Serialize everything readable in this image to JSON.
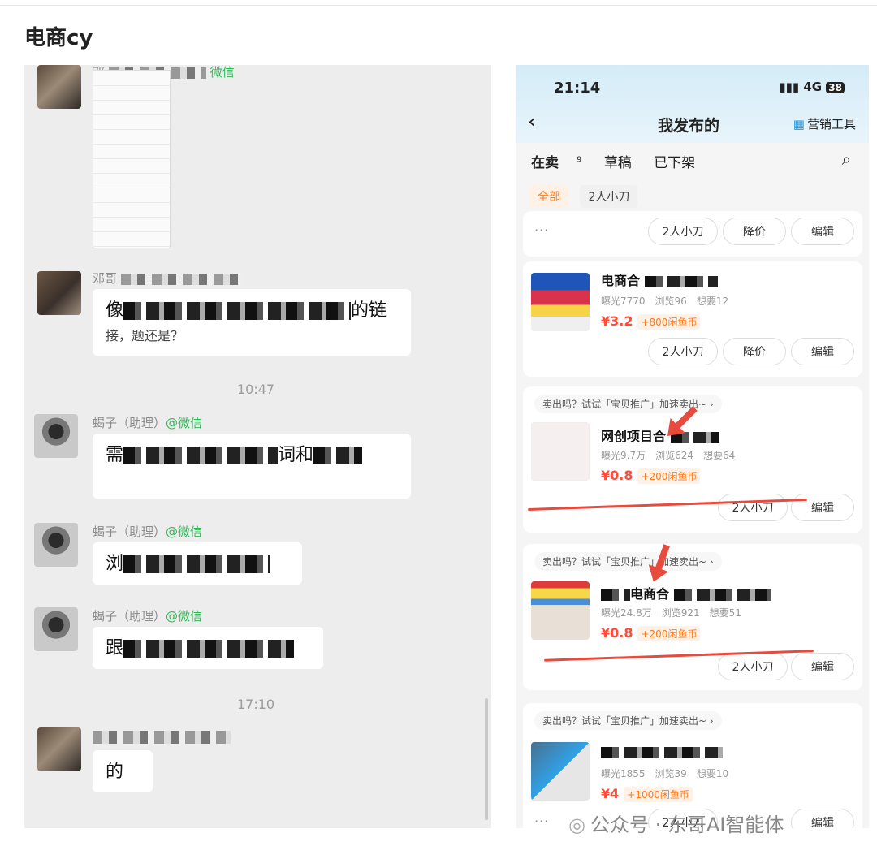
{
  "page_title": "电商cy",
  "chat": {
    "messages": [
      {
        "nick": "邓",
        "wx": "微信"
      },
      {
        "nick": "邓哥",
        "wx": "",
        "text_start": "像",
        "text_end": "的链",
        "text_line2": "接，题还是？"
      },
      {
        "time": "10:47"
      },
      {
        "nick": "蝎子（助理）",
        "wx": "@微信",
        "text_start": "需",
        "text_end": "词和"
      },
      {
        "nick": "蝎子（助理）",
        "wx": "@微信",
        "text_start": "浏"
      },
      {
        "nick": "蝎子（助理）",
        "wx": "@微信",
        "text_start": "跟"
      },
      {
        "time": "17:10"
      },
      {
        "nick": "",
        "wx": "",
        "text_end": "的"
      }
    ]
  },
  "phone": {
    "status_time": "21:14",
    "status_net": "4G",
    "battery": "38",
    "back_icon": "chevron-left-icon",
    "title": "我发布的",
    "tools_label": "营销工具",
    "tabs": [
      {
        "label": "在卖",
        "badge": "9"
      },
      {
        "label": "草稿"
      },
      {
        "label": "已下架"
      }
    ],
    "filters": [
      "全部",
      "2人小刀"
    ],
    "top_actions": [
      "2人小刀",
      "降价",
      "编辑"
    ],
    "promo_text": "卖出吗？试试「宝贝推广」加速卖出~",
    "products": [
      {
        "title": "电商合",
        "exposure": "曝光7770",
        "views": "浏览96",
        "wants": "想要12",
        "price": "¥3.2",
        "coin": "+800闲鱼币",
        "actions": [
          "2人小刀",
          "降价",
          "编辑"
        ]
      },
      {
        "title": "网创项目合",
        "exposure": "曝光9.7万",
        "views": "浏览624",
        "wants": "想要64",
        "price": "¥0.8",
        "coin": "+200闲鱼币",
        "actions": [
          "2人小刀",
          "编辑"
        ]
      },
      {
        "title": "电商合",
        "exposure": "曝光24.8万",
        "views": "浏览921",
        "wants": "想要51",
        "price": "¥0.8",
        "coin": "+200闲鱼币",
        "actions": [
          "2人小刀",
          "编辑"
        ]
      },
      {
        "title": "",
        "exposure": "曝光1855",
        "views": "浏览39",
        "wants": "想要10",
        "price": "¥4",
        "coin": "+1000闲鱼币",
        "actions": [
          "2人小刀",
          "编辑"
        ]
      }
    ]
  },
  "watermark": "公众号 · 东哥AI智能体",
  "colors": {
    "price": "#ff4b3a",
    "coin": "#ff7a1a",
    "wechat": "#2dbb55",
    "annotation": "#e84a3d"
  }
}
